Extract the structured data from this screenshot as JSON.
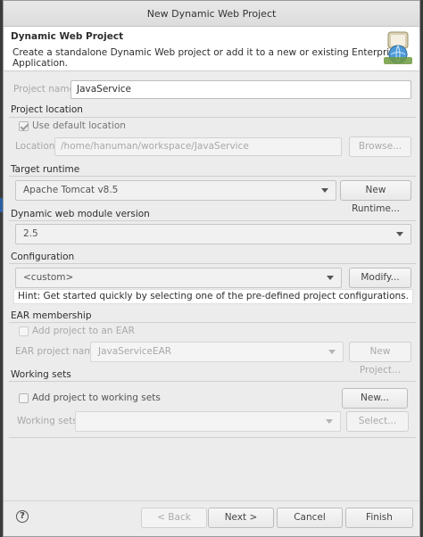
{
  "window": {
    "title": "New Dynamic Web Project"
  },
  "banner": {
    "heading": "Dynamic Web Project",
    "description": "Create a standalone Dynamic Web project or add it to a new or existing Enterprise Application."
  },
  "project": {
    "name_label": "Project name:",
    "name_value": "JavaService"
  },
  "location": {
    "group_title": "Project location",
    "use_default_label": "Use default location",
    "location_label": "Location:",
    "location_value": "/home/hanuman/workspace/JavaService",
    "browse_label": "Browse..."
  },
  "runtime": {
    "group_title": "Target runtime",
    "selected": "Apache Tomcat v8.5",
    "new_runtime_label": "New Runtime..."
  },
  "module": {
    "group_title": "Dynamic web module version",
    "selected": "2.5"
  },
  "configuration": {
    "group_title": "Configuration",
    "selected": "<custom>",
    "modify_label": "Modify...",
    "hint": "Hint: Get started quickly by selecting one of the pre-defined project configurations."
  },
  "ear": {
    "group_title": "EAR membership",
    "add_label": "Add project to an EAR",
    "name_label": "EAR project name:",
    "name_value": "JavaServiceEAR",
    "new_project_label": "New Project..."
  },
  "working_sets": {
    "group_title": "Working sets",
    "add_label": "Add project to working sets",
    "new_label": "New...",
    "sets_label": "Working sets:",
    "sets_value": "",
    "select_label": "Select..."
  },
  "footer": {
    "help_glyph": "?",
    "back_label": "< Back",
    "next_label": "Next >",
    "cancel_label": "Cancel",
    "finish_label": "Finish"
  }
}
